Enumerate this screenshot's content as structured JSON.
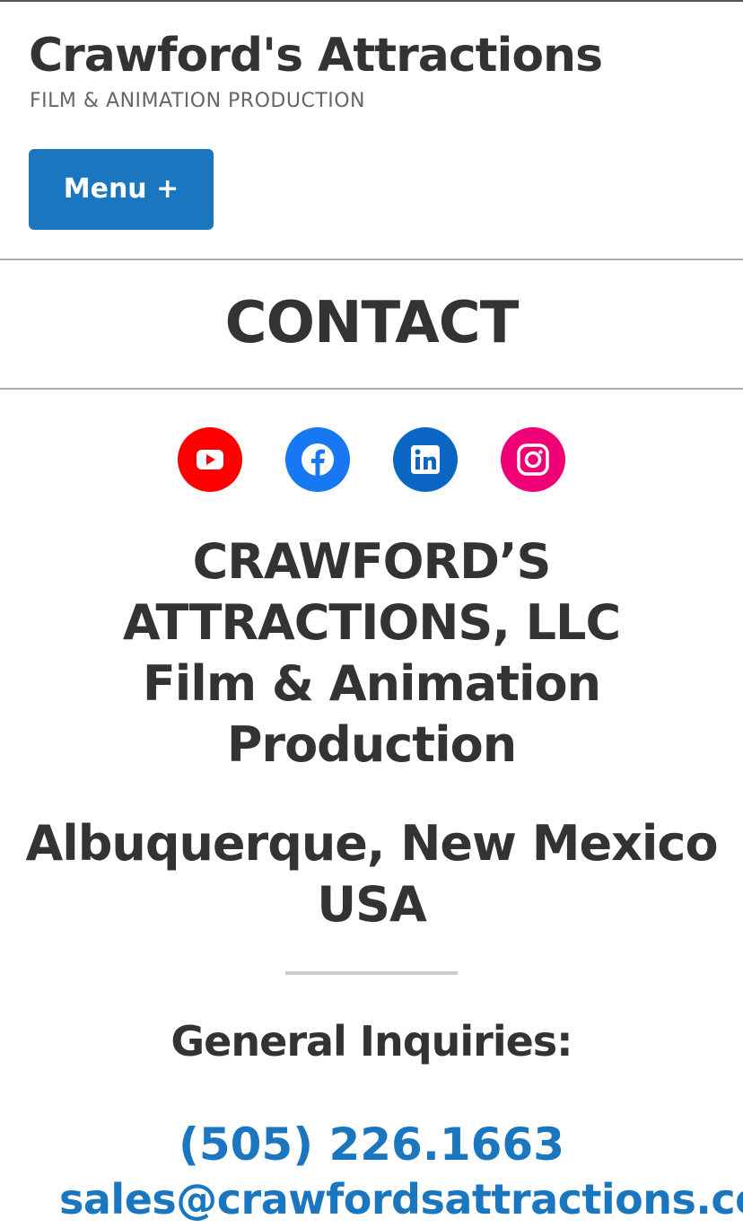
{
  "header": {
    "site_title": "Crawford's Attractions",
    "tagline": "FILM & ANIMATION PRODUCTION",
    "menu_label": "Menu +"
  },
  "page": {
    "title": "CONTACT"
  },
  "social": [
    {
      "icon": "youtube-icon",
      "color": "#ff0000"
    },
    {
      "icon": "facebook-icon",
      "color": "#1877f2"
    },
    {
      "icon": "linkedin-icon",
      "color": "#0a66c2"
    },
    {
      "icon": "instagram-icon",
      "color": "#f00075"
    }
  ],
  "company": {
    "lines": [
      "CRAWFORD’S",
      "ATTRACTIONS, LLC",
      "Film & Animation",
      "Production"
    ]
  },
  "location": {
    "lines": [
      "Albuquerque, New Mexico",
      "USA"
    ]
  },
  "inquiries": {
    "heading": "General Inquiries:",
    "phone": "(505) 226.1663",
    "email": "sales@crawfordsattractions.co"
  },
  "colors": {
    "accent": "#1a77bf",
    "text": "#333333",
    "muted": "#666666"
  }
}
